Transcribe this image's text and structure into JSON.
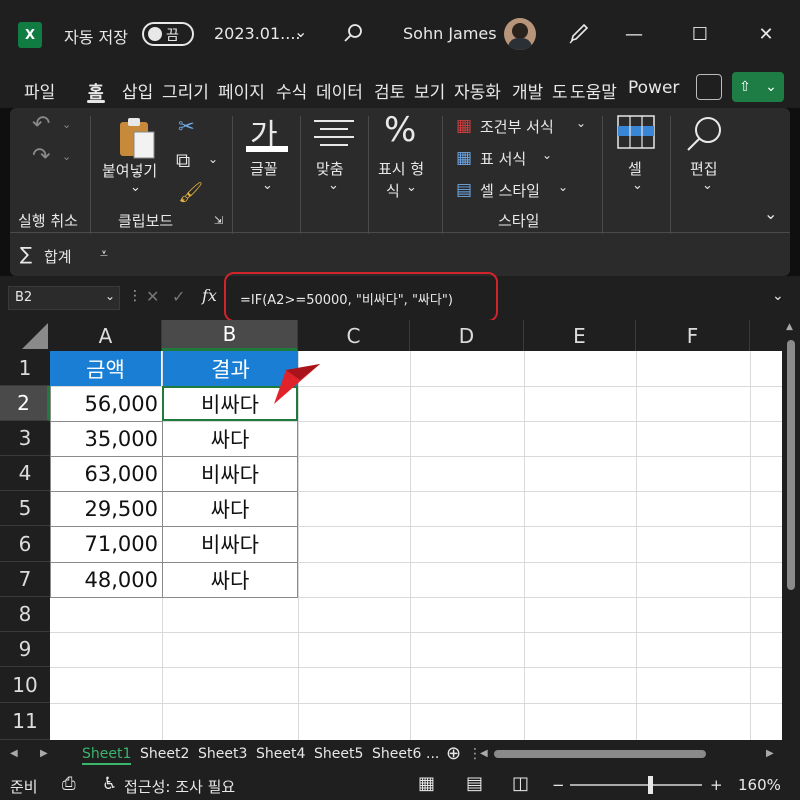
{
  "titlebar": {
    "app_icon": "X",
    "autosave_label": "자동 저장",
    "autosave_toggle": "끔",
    "doc_title": "2023.01....",
    "user_name": "Sohn James",
    "minimize": "—",
    "maximize": "☐",
    "close": "✕"
  },
  "tabs": [
    "파일",
    "홈",
    "삽입",
    "그리기",
    "페이지",
    "수식",
    "데이터",
    "검토",
    "보기",
    "자동화",
    "개발",
    "도",
    "도움말",
    "Power"
  ],
  "ribbon": {
    "undo_group": "실행 취소",
    "paste": "붙여넣기",
    "clipboard_group": "클립보드",
    "font_glyph": "가",
    "font": "글꼴",
    "align": "맞춤",
    "number_sym": "%",
    "number_line1": "표시 형",
    "number_line2": "식",
    "cond_format": "조건부 서식",
    "table_format": "표 서식",
    "cell_style": "셀 스타일",
    "styles_group": "스타일",
    "cells": "셀",
    "editing": "편집",
    "autosum": "합계"
  },
  "formula_bar": {
    "name_box": "B2",
    "fx": "fx",
    "formula": "=IF(A2>=50000, \"비싸다\", \"싸다\")"
  },
  "grid": {
    "columns": [
      "A",
      "B",
      "C",
      "D",
      "E",
      "F"
    ],
    "rows": [
      "1",
      "2",
      "3",
      "4",
      "5",
      "6",
      "7",
      "8",
      "9",
      "10",
      "11"
    ],
    "header_a": "금액",
    "header_b": "결과",
    "data": [
      {
        "amount": "56,000",
        "result": "비싸다"
      },
      {
        "amount": "35,000",
        "result": "싸다"
      },
      {
        "amount": "63,000",
        "result": "비싸다"
      },
      {
        "amount": "29,500",
        "result": "싸다"
      },
      {
        "amount": "71,000",
        "result": "비싸다"
      },
      {
        "amount": "48,000",
        "result": "싸다"
      }
    ]
  },
  "sheets": [
    "Sheet1",
    "Sheet2",
    "Sheet3",
    "Sheet4",
    "Sheet5",
    "Sheet6"
  ],
  "sheet_more": "...",
  "statusbar": {
    "ready": "준비",
    "accessibility": "접근성: 조사 필요",
    "zoom_minus": "−",
    "zoom_plus": "+",
    "zoom": "160%"
  },
  "colors": {
    "header_fill": "#1a7fd4",
    "accent_green": "#107c41",
    "highlight_red": "#d0232a"
  }
}
